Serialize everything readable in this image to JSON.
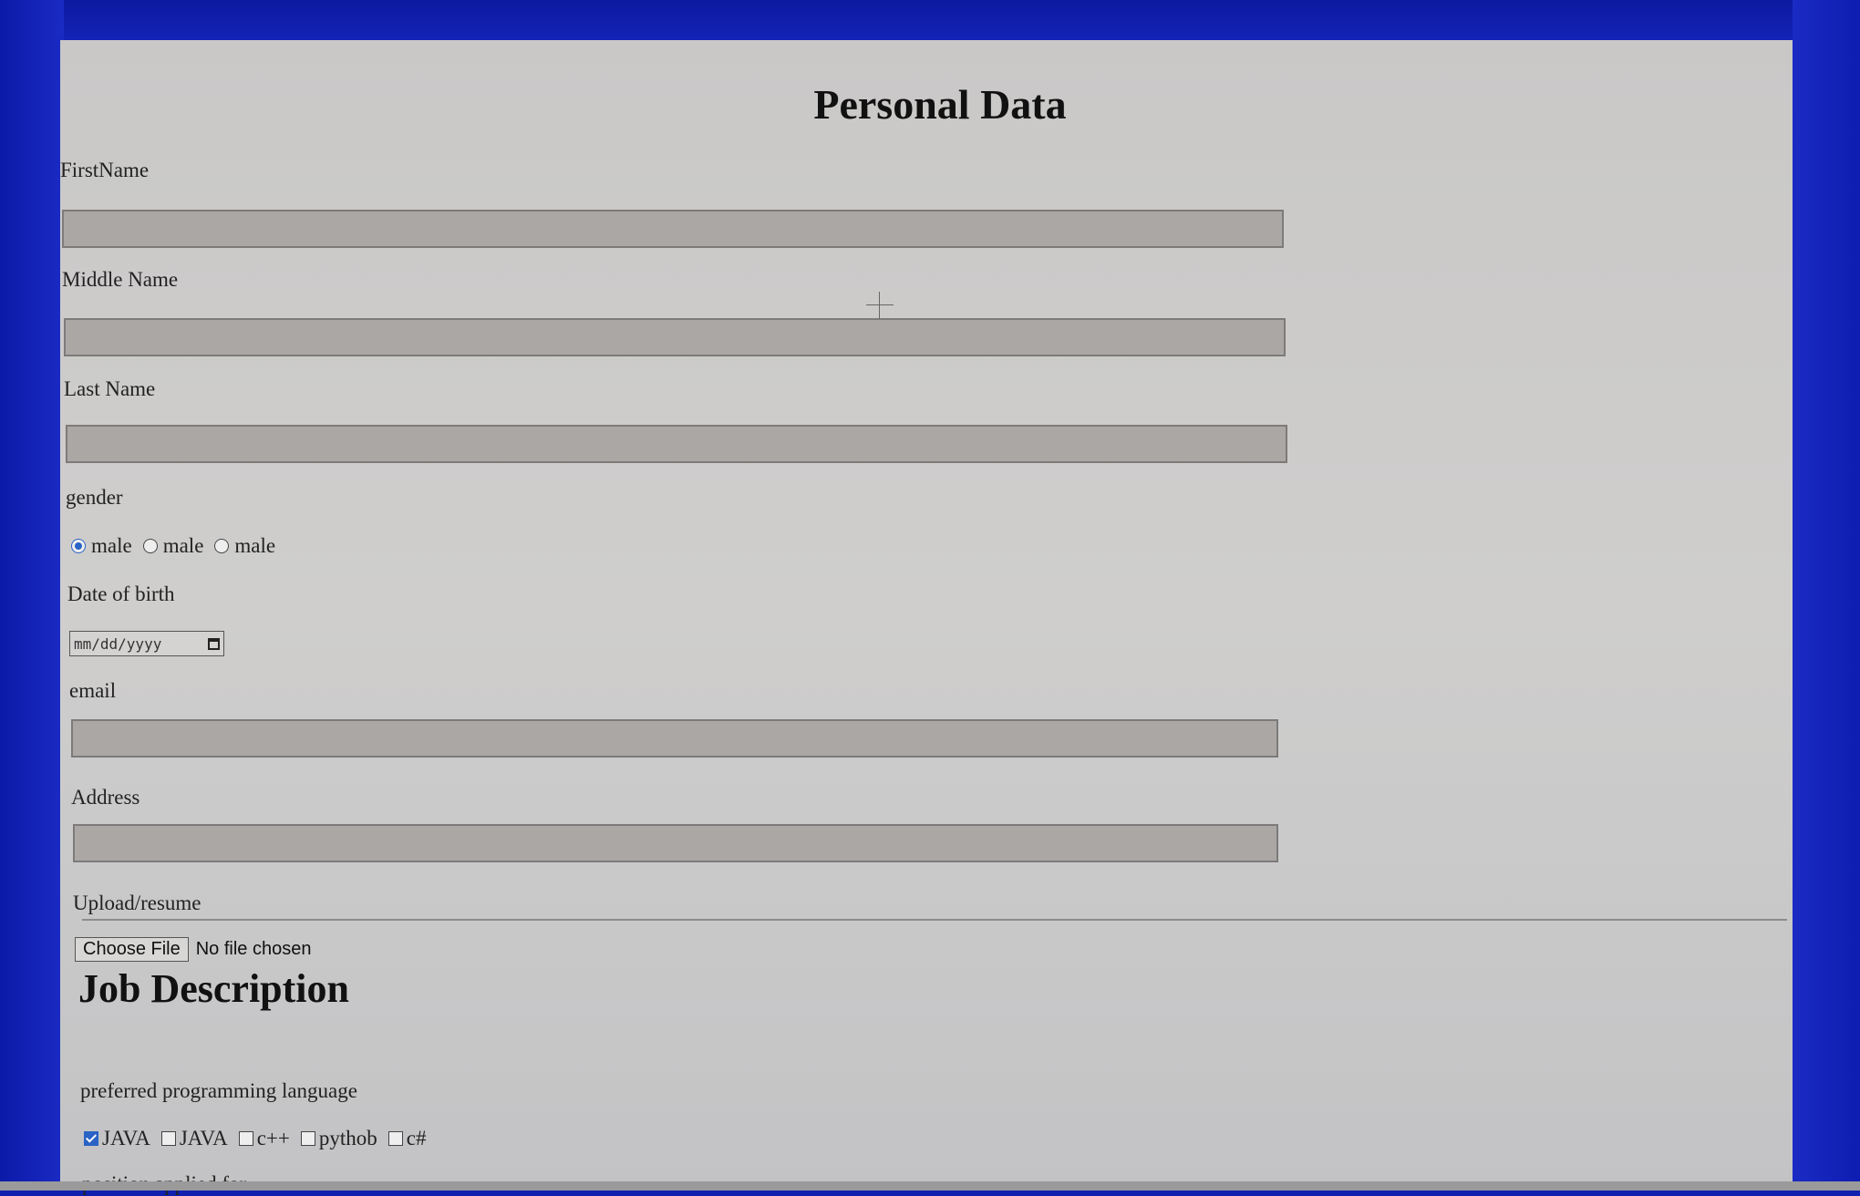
{
  "form": {
    "title": "Personal Data",
    "fields": {
      "first_name_label": "FirstName",
      "middle_name_label": "Middle Name",
      "last_name_label": "Last Name",
      "gender_label": "gender",
      "gender_options": [
        "male",
        "male",
        "male"
      ],
      "gender_selected_index": 0,
      "dob_label": "Date of birth",
      "dob_placeholder": "mm/dd/yyyy",
      "email_label": "email",
      "address_label": "Address",
      "upload_label": "Upload/resume",
      "choose_file_label": "Choose File",
      "no_file_text": "No file chosen"
    },
    "job": {
      "title": "Job Description",
      "language_label": "preferred programming language",
      "languages": [
        "JAVA",
        "JAVA",
        "c++",
        "pythob",
        "c#"
      ],
      "languages_checked": [
        true,
        false,
        false,
        false,
        false
      ],
      "position_label": "position applied for"
    }
  },
  "colors": {
    "background_blue": "#1020b0",
    "page_gray": "#cfcecd",
    "input_gray": "#aba7a5",
    "accent": "#2a63c5"
  }
}
